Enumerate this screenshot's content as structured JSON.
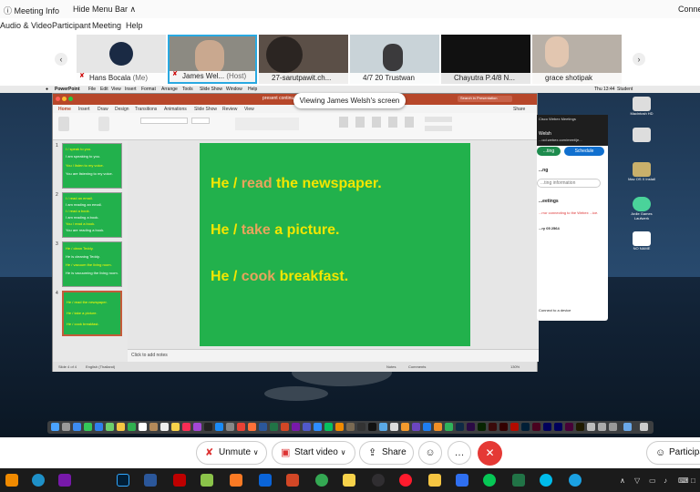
{
  "topbar": {
    "meeting_info": "Meeting Info",
    "hide_menu_bar": "Hide Menu Bar",
    "connection": "Connec"
  },
  "menubar": {
    "audio_video": "Audio & Video",
    "participant": "Participant",
    "meeting": "Meeting",
    "help": "Help"
  },
  "participants": [
    {
      "name": "Hans Bocala",
      "suffix": "(Me)"
    },
    {
      "name": "James Wel...",
      "suffix": "(Host)"
    },
    {
      "name": "27-sarutpawit.ch...",
      "suffix": ""
    },
    {
      "name": "4/7 20 Trustwan",
      "suffix": ""
    },
    {
      "name": "Chayutra P.4/8 N...",
      "suffix": ""
    },
    {
      "name": "grace shotipak",
      "suffix": ""
    }
  ],
  "share_banner": "Viewing James Welsh's screen",
  "mac_menu": {
    "app": "PowerPoint",
    "items": [
      "File",
      "Edit",
      "View",
      "Insert",
      "Format",
      "Arrange",
      "Tools",
      "Slide Show",
      "Window",
      "Help"
    ],
    "clock": "Thu 13:44",
    "user": "Student"
  },
  "ppt": {
    "doc_title": "present continu...",
    "search_placeholder": "Search in Presentation",
    "tabs": [
      "Home",
      "Insert",
      "Draw",
      "Design",
      "Transitions",
      "Animations",
      "Slide Show",
      "Review",
      "View"
    ],
    "share_label": "Share",
    "slide_count": "Slide 4 of 4",
    "language": "English (Thailand)",
    "notes_placeholder": "Click to add notes",
    "notes_btn": "Notes",
    "comments_btn": "Comments",
    "zoom": "130%"
  },
  "thumbnails": [
    {
      "num": "1",
      "lines": [
        "I / speak to you.",
        "I am speaking to you.",
        "You / listen to my voice.",
        "You are listening to my voice."
      ]
    },
    {
      "num": "2",
      "lines": [
        "I / read an email.",
        "I am reading an email.",
        "I / read a book.",
        "I am reading a book.",
        "You / read a book.",
        "You are reading a book."
      ]
    },
    {
      "num": "3",
      "lines": [
        "He / clean Teddy.",
        "He is cleaning Teddy.",
        "He / vacuum the living room.",
        "He is vacuuming the living room."
      ]
    },
    {
      "num": "4",
      "lines": [
        "He / read the newspaper.",
        "He / take a picture.",
        "He / cook breakfast."
      ]
    }
  ],
  "slide": {
    "lines": [
      {
        "a": "He / ",
        "verb": "read",
        "rest": " the newspaper."
      },
      {
        "a": "He / ",
        "verb": "take",
        "rest": " a picture."
      },
      {
        "a": "He / ",
        "verb": "cook",
        "rest": " breakfast."
      }
    ],
    "colors": {
      "subject": "#f2e600",
      "verb": "#e8a45c",
      "background": "#22b14c"
    }
  },
  "webex": {
    "title": "Cisco Webex Meetings",
    "user": "Welsh",
    "url": "...ool.webex.com/meet/je...",
    "start_label": "...ting",
    "schedule_label": "Schedule",
    "section": "...ng",
    "join_info": "...ting information",
    "meetings_header": "...eetings",
    "error": "...rror connecting to the Webex ...ice.",
    "date": "...ry 05 2564",
    "connect": "Connect to a device"
  },
  "desktop_icons": [
    "Macintosh HD",
    "",
    "Mac OS X Install",
    "Ardie Games Laufwerk",
    "NO NAME"
  ],
  "controls": {
    "mute": "Unmute",
    "video": "Start video",
    "share": "Share",
    "participants": "Participan"
  }
}
